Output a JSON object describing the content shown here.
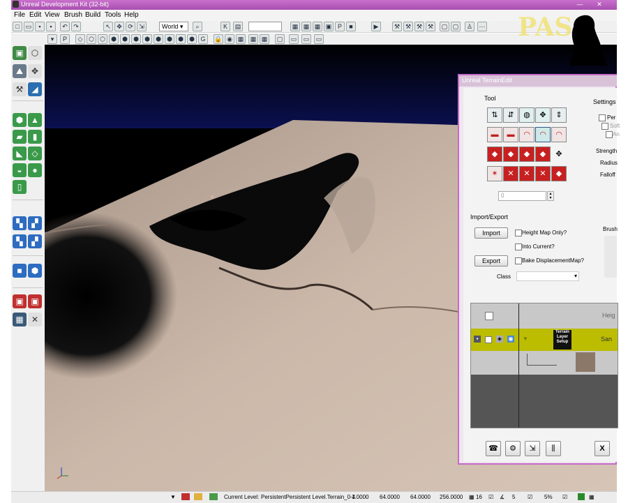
{
  "window": {
    "title": "Unreal Development Kit (32-bit)",
    "minimize": "—",
    "close": "✕"
  },
  "menu": [
    "File",
    "Edit",
    "View",
    "Brush",
    "Build",
    "Tools",
    "Help"
  ],
  "toolbar": {
    "coord_system": "World",
    "coord_arrow": "▾"
  },
  "watermark": "PAS",
  "terrain_dialog": {
    "title": "Unreal TerrainEdit",
    "tool_label": "Tool",
    "settings_label": "Settings",
    "settings_items": [
      "Per",
      "Soft",
      "An",
      "Strength",
      "Radius",
      "Falloff"
    ],
    "number_field": "0",
    "import_export_label": "Import/Export",
    "import_button": "Import",
    "export_button": "Export",
    "height_map_only": "Height Map Only?",
    "into_current": "Into Current?",
    "bake_displacement": "Bake DisplacementMap?",
    "class_label": "Class",
    "brush_label": "Brush",
    "layers_header": "Heig",
    "layer_name": "San",
    "layer_badge": "Terrain Layer Setup",
    "close_button": "X"
  },
  "status": {
    "current_level_label": "Current Level:",
    "current_level": "PersistentPersistent Level.Terrain_0-4",
    "values": [
      "1.0000",
      "64.0000",
      "64.0000",
      "256.0000"
    ],
    "grid": "16",
    "rot": "5",
    "zoom": "5%"
  },
  "colors": {
    "title_bar": "#b760bb",
    "dialog_border": "#c56bc8",
    "layer_row": "#bcbd00",
    "terrain": "#cbb8a9"
  }
}
